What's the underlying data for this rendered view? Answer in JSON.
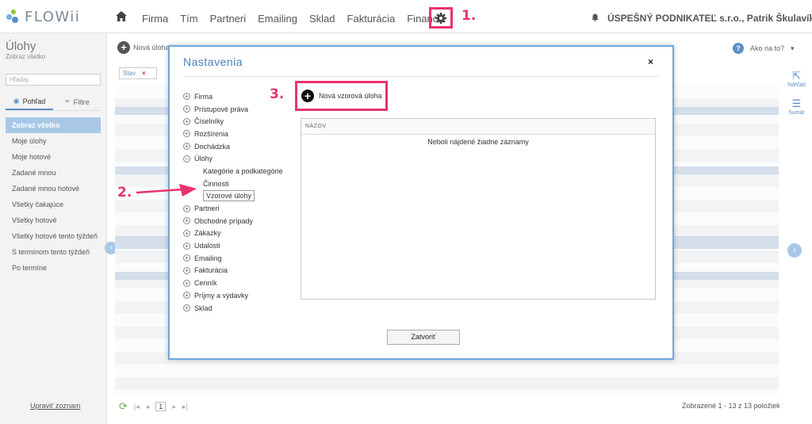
{
  "app": {
    "logo_text": "FLOWii"
  },
  "nav": {
    "links": [
      "Firma",
      "Tím",
      "Partneri",
      "Emailing",
      "Sklad",
      "Fakturácia",
      "Financie"
    ],
    "user_company": "ÚSPEŠNÝ PODNIKATEĽ s.r.o., Patrik Škulavík"
  },
  "annotations": {
    "step1": "1.",
    "step2": "2.",
    "step3": "3."
  },
  "page": {
    "title": "Úlohy",
    "subtitle": "Zobraz všetko"
  },
  "sidebar": {
    "search_placeholder": "Hľadaj...",
    "tab_view": "Pohľad",
    "tab_filter": "Filtre",
    "items": [
      "Zobraz všetko",
      "Moje úlohy",
      "Moje hotové",
      "Zadané mnou",
      "Zadané mnou hotové",
      "Všetky čakajúce",
      "Všetky hotové",
      "Všetky hotové tento týždeň",
      "S termínom tento týždeň",
      "Po termíne"
    ],
    "footer_link": "Upraviť zoznam"
  },
  "toolbar": {
    "new_task": "Nová úloha",
    "help": "Ako na to?"
  },
  "filter_chip": {
    "label": "Stav",
    "remove": "×"
  },
  "right_panel": {
    "preview": "Náhľad",
    "summary": "Sumár"
  },
  "pager": {
    "page": "1"
  },
  "footer_count": "Zobrazené 1 - 13 z 13 položiek",
  "modal": {
    "title": "Nastavenia",
    "close": "×",
    "tree": {
      "before": [
        "Firma",
        "Prístupové práva",
        "Číselníky",
        "Rozšírenia",
        "Dochádzka"
      ],
      "expanded": "Úlohy",
      "children": [
        "Kategórie a podkategórie",
        "Činnosti",
        "Vzorové úlohy"
      ],
      "after": [
        "Partneri",
        "Obchodné prípady",
        "Zákazky",
        "Udalosti",
        "Emailing",
        "Fakturácia",
        "Cenník",
        "Príjmy a výdavky",
        "Sklad"
      ]
    },
    "new_button": "Nová vzorová úloha",
    "table_header": "NÁZOV",
    "empty_text": "Neboli nájdené žiadne záznamy",
    "close_button": "Zatvoriť"
  },
  "colors": {
    "accent": "#e8336d",
    "blue": "#4a7fb5",
    "selected": "#a9c8e8"
  }
}
